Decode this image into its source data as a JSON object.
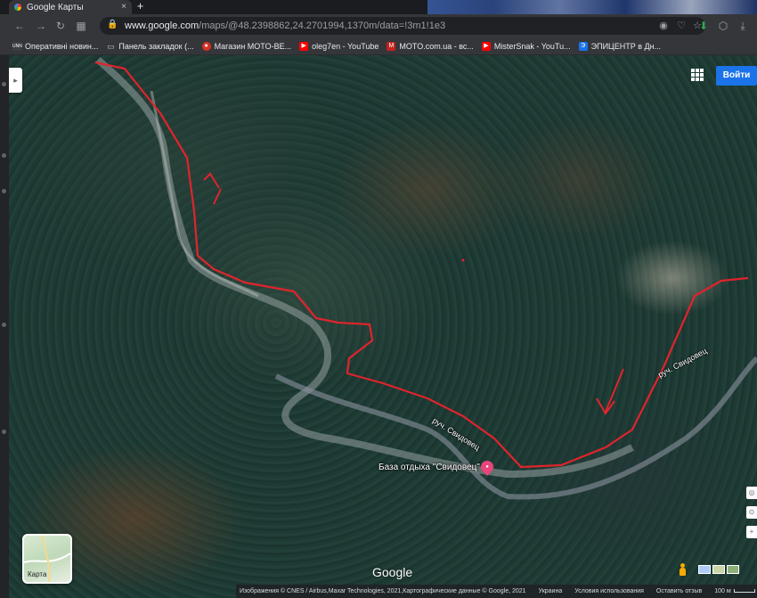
{
  "browser": {
    "tab_title": "Google Карты",
    "tab_close": "×",
    "new_tab": "+",
    "url_domain": "www.google.com",
    "url_rest": "/maps/@48.2398862,24.2701994,1370m/data=!3m1!1e3"
  },
  "bookmarks": [
    {
      "label": "Оперативні новин...",
      "icon_color": "#3c4043",
      "icon_text": "UNN"
    },
    {
      "label": "Панель закладок (...",
      "icon_color": "#5f6368",
      "icon_text": "▭"
    },
    {
      "label": "Магазин MOTO-BE...",
      "icon_color": "#d93025",
      "icon_text": "●"
    },
    {
      "label": "oleg7en - YouTube",
      "icon_color": "#ff0000",
      "icon_text": "▶"
    },
    {
      "label": "MOTO.com.ua - вс...",
      "icon_color": "#c5221f",
      "icon_text": "M"
    },
    {
      "label": "MisterSnak - YouTu...",
      "icon_color": "#ff0000",
      "icon_text": "▶"
    },
    {
      "label": "ЭПИЦЕНТР в Дн...",
      "icon_color": "#1a73e8",
      "icon_text": "Э"
    }
  ],
  "map": {
    "signin_label": "Войти",
    "panel_toggle": "▸",
    "poi_label": "База отдыха \"Свидовец\"",
    "pin_text": "●",
    "street_labels": [
      "руч. Свидовец",
      "руч. Свидовец"
    ],
    "minimap_label": "Карта",
    "google_logo": "Google",
    "attribution": "Изображения © CNES / Airbus,Maxar Technologies, 2021,Картографические данные © Google, 2021",
    "links": [
      "Украина",
      "Условия использования",
      "Оставить отзыв"
    ],
    "scale": "100 м",
    "zoom_in": "+",
    "compass": "◎"
  },
  "colors": {
    "route": "#e0242c",
    "signin": "#1a73e8",
    "pin": "#e8457c"
  }
}
